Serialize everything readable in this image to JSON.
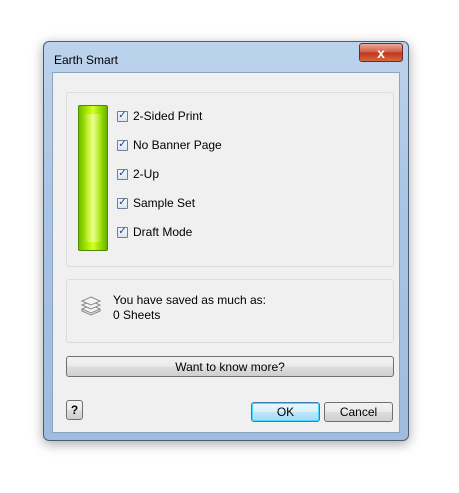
{
  "window": {
    "title": "Earth Smart",
    "close_glyph": "x"
  },
  "options": [
    {
      "label": "2-Sided Print",
      "checked": true
    },
    {
      "label": "No Banner Page",
      "checked": true
    },
    {
      "label": "2-Up",
      "checked": true
    },
    {
      "label": "Sample Set",
      "checked": true
    },
    {
      "label": "Draft Mode",
      "checked": true
    }
  ],
  "checkmark": "✓",
  "gauge": {
    "level": 1.0,
    "color": "#a6e800"
  },
  "savings": {
    "line1": "You have saved as much as:",
    "line2": "0 Sheets",
    "icon": "paper-stack-icon"
  },
  "buttons": {
    "more": "Want to know more?",
    "help": "?",
    "ok": "OK",
    "cancel": "Cancel"
  }
}
